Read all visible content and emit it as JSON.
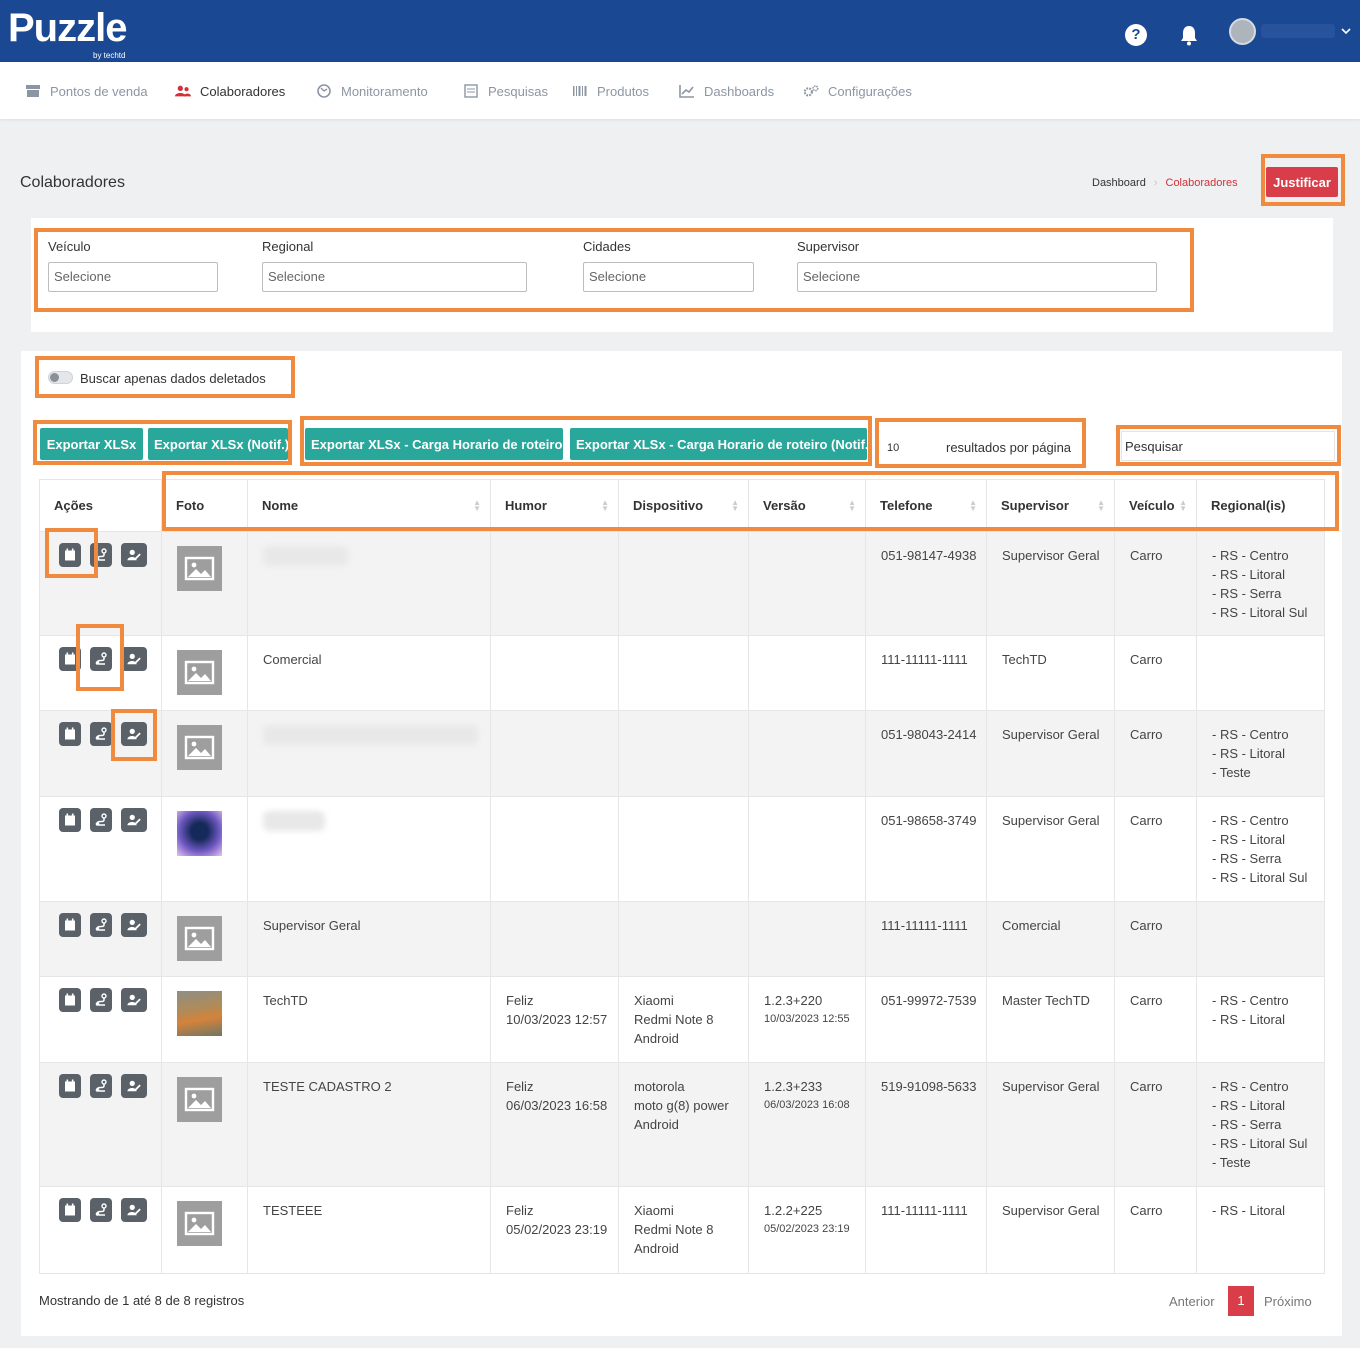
{
  "header": {
    "logo": "Puzzle",
    "logo_sub": "by techtd",
    "help_icon": "?",
    "bell": "bell-icon",
    "avatar": "avatar-icon"
  },
  "nav": {
    "items": [
      {
        "label": "Pontos de venda",
        "icon": "store-icon"
      },
      {
        "label": "Colaboradores",
        "icon": "users-icon"
      },
      {
        "label": "Monitoramento",
        "icon": "map-icon"
      },
      {
        "label": "Pesquisas",
        "icon": "form-icon"
      },
      {
        "label": "Produtos",
        "icon": "barcode-icon"
      },
      {
        "label": "Dashboards",
        "icon": "chart-icon"
      },
      {
        "label": "Configurações",
        "icon": "gears-icon"
      }
    ]
  },
  "page": {
    "title": "Colaboradores",
    "breadcrumb": [
      "Dashboard",
      "Colaboradores"
    ],
    "justify_button": "Justificar"
  },
  "filters": [
    {
      "label": "Veículo",
      "placeholder": "Selecione"
    },
    {
      "label": "Regional",
      "placeholder": "Selecione"
    },
    {
      "label": "Cidades",
      "placeholder": "Selecione"
    },
    {
      "label": "Supervisor",
      "placeholder": "Selecione"
    }
  ],
  "toggle_label": "Buscar apenas dados deletados",
  "export_buttons": [
    "Exportar XLSx",
    "Exportar XLSx (Notif.)",
    "Exportar XLSx - Carga Horario de roteiro",
    "Exportar XLSx - Carga Horario de roteiro (Notif.)"
  ],
  "per_page": {
    "value": "10",
    "label": "resultados por página"
  },
  "search_placeholder": "Pesquisar",
  "columns": [
    "Ações",
    "Foto",
    "Nome",
    "Humor",
    "Dispositivo",
    "Versão",
    "Telefone",
    "Supervisor",
    "Veículo",
    "Regional(is)"
  ],
  "rows": [
    {
      "nome": "",
      "humor": [
        "",
        ""
      ],
      "dispositivo": [
        "",
        "",
        ""
      ],
      "versao": [
        "",
        ""
      ],
      "telefone": "051-98147-4938",
      "supervisor": "Supervisor Geral",
      "veiculo": "Carro",
      "regionais": [
        "- RS - Centro",
        "- RS - Litoral",
        "- RS - Serra",
        "- RS - Litoral Sul",
        ""
      ]
    },
    {
      "nome": "Comercial",
      "humor": [
        "",
        ""
      ],
      "dispositivo": [
        "",
        "",
        ""
      ],
      "versao": [
        "",
        ""
      ],
      "telefone": "111-11111-1111",
      "supervisor": "TechTD",
      "veiculo": "Carro",
      "regionais": [
        "",
        "",
        "",
        "",
        ""
      ]
    },
    {
      "nome": "",
      "humor": [
        "",
        ""
      ],
      "dispositivo": [
        "",
        "",
        ""
      ],
      "versao": [
        "",
        ""
      ],
      "telefone": "051-98043-2414",
      "supervisor": "Supervisor Geral",
      "veiculo": "Carro",
      "regionais": [
        "- RS - Centro",
        "- RS - Litoral",
        "- Teste",
        "",
        ""
      ]
    },
    {
      "nome": "",
      "humor": [
        "",
        ""
      ],
      "dispositivo": [
        "",
        "",
        ""
      ],
      "versao": [
        "",
        ""
      ],
      "telefone": "051-98658-3749",
      "supervisor": "Supervisor Geral",
      "veiculo": "Carro",
      "regionais": [
        "- RS - Centro",
        "- RS - Litoral",
        "- RS - Serra",
        "- RS - Litoral Sul",
        ""
      ]
    },
    {
      "nome": "Supervisor Geral",
      "humor": [
        "",
        ""
      ],
      "dispositivo": [
        "",
        "",
        ""
      ],
      "versao": [
        "",
        ""
      ],
      "telefone": "111-11111-1111",
      "supervisor": "Comercial",
      "veiculo": "Carro",
      "regionais": [
        "",
        "",
        "",
        "",
        ""
      ]
    },
    {
      "nome": "TechTD",
      "humor": [
        "Feliz",
        "10/03/2023 12:57"
      ],
      "dispositivo": [
        "Xiaomi",
        "Redmi Note 8",
        "Android"
      ],
      "versao": [
        "1.2.3+220",
        "10/03/2023 12:55"
      ],
      "telefone": "051-99972-7539",
      "supervisor": "Master TechTD",
      "veiculo": "Carro",
      "regionais": [
        "- RS - Centro",
        "- RS - Litoral",
        "",
        "",
        ""
      ]
    },
    {
      "nome": "TESTE CADASTRO 2",
      "humor": [
        "Feliz",
        "06/03/2023 16:58"
      ],
      "dispositivo": [
        "motorola",
        "moto g(8) power",
        "Android"
      ],
      "versao": [
        "1.2.3+233",
        "06/03/2023 16:08"
      ],
      "telefone": "519-91098-5633",
      "supervisor": "Supervisor Geral",
      "veiculo": "Carro",
      "regionais": [
        "- RS - Centro",
        "- RS - Litoral",
        "- RS - Serra",
        "- RS - Litoral Sul",
        "- Teste"
      ]
    },
    {
      "nome": "TESTEEE",
      "humor": [
        "Feliz",
        "05/02/2023 23:19"
      ],
      "dispositivo": [
        "Xiaomi",
        "Redmi Note 8",
        "Android"
      ],
      "versao": [
        "1.2.2+225",
        "05/02/2023 23:19"
      ],
      "telefone": "111-11111-1111",
      "supervisor": "Supervisor Geral",
      "veiculo": "Carro",
      "regionais": [
        "- RS - Litoral",
        "",
        "",
        "",
        ""
      ]
    }
  ],
  "footer": {
    "info": "Mostrando de 1 até 8 de 8 registros",
    "prev": "Anterior",
    "page": "1",
    "next": "Próximo"
  },
  "colors": {
    "brand": "#1b4892",
    "danger": "#d93d49",
    "export": "#2aa79b",
    "highlight": "#f08a3e"
  }
}
